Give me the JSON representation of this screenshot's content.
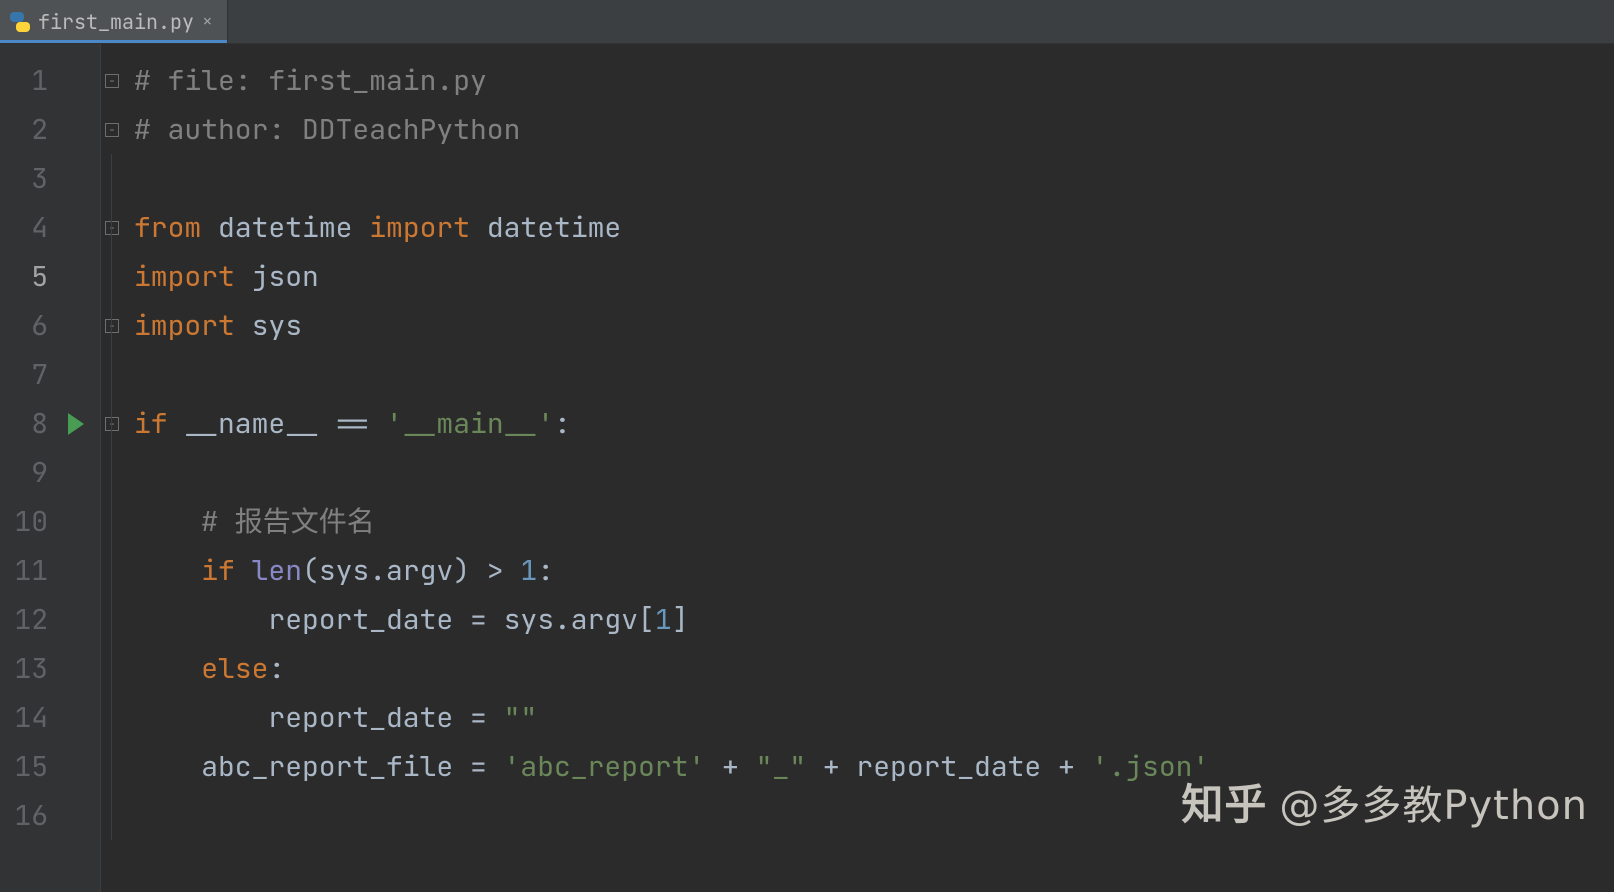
{
  "tab": {
    "filename": "first_main.py",
    "close": "×"
  },
  "code": {
    "lines": [
      {
        "n": "1",
        "segs": [
          {
            "cls": "c-comment",
            "t": "# file: first_main.py"
          }
        ],
        "fold": "-",
        "indent": 0
      },
      {
        "n": "2",
        "segs": [
          {
            "cls": "c-comment",
            "t": "# author: DDTeachPython"
          }
        ],
        "fold": "-",
        "indent": 0
      },
      {
        "n": "3",
        "segs": [],
        "indent": 0
      },
      {
        "n": "4",
        "segs": [
          {
            "cls": "c-keyword",
            "t": "from "
          },
          {
            "cls": "c-text",
            "t": "datetime "
          },
          {
            "cls": "c-keyword",
            "t": "import "
          },
          {
            "cls": "c-text",
            "t": "datetime"
          }
        ],
        "fold": "-",
        "indent": 0
      },
      {
        "n": "5",
        "segs": [
          {
            "cls": "c-keyword",
            "t": "import "
          },
          {
            "cls": "c-text",
            "t": "json"
          }
        ],
        "indent": 0,
        "hl": true
      },
      {
        "n": "6",
        "segs": [
          {
            "cls": "c-keyword",
            "t": "import "
          },
          {
            "cls": "c-text",
            "t": "sys"
          }
        ],
        "fold": "-",
        "indent": 0
      },
      {
        "n": "7",
        "segs": [],
        "indent": 0
      },
      {
        "n": "8",
        "segs": [
          {
            "cls": "c-keyword",
            "t": "if "
          },
          {
            "cls": "c-text",
            "t": "__name__ == "
          },
          {
            "cls": "c-str",
            "t": "'__main__'"
          },
          {
            "cls": "c-text",
            "t": ":"
          }
        ],
        "fold": "-",
        "run": true,
        "indent": 0
      },
      {
        "n": "9",
        "segs": [],
        "indent": 1
      },
      {
        "n": "10",
        "segs": [
          {
            "cls": "c-comment",
            "t": "# 报告文件名"
          }
        ],
        "indent": 1
      },
      {
        "n": "11",
        "segs": [
          {
            "cls": "c-keyword",
            "t": "if "
          },
          {
            "cls": "c-builtin",
            "t": "len"
          },
          {
            "cls": "c-text",
            "t": "(sys.argv) > "
          },
          {
            "cls": "c-num",
            "t": "1"
          },
          {
            "cls": "c-text",
            "t": ":"
          }
        ],
        "indent": 1
      },
      {
        "n": "12",
        "segs": [
          {
            "cls": "c-text",
            "t": "report_date = sys.argv["
          },
          {
            "cls": "c-num",
            "t": "1"
          },
          {
            "cls": "c-text",
            "t": "]"
          }
        ],
        "indent": 2
      },
      {
        "n": "13",
        "segs": [
          {
            "cls": "c-keyword",
            "t": "else"
          },
          {
            "cls": "c-text",
            "t": ":"
          }
        ],
        "indent": 1
      },
      {
        "n": "14",
        "segs": [
          {
            "cls": "c-text",
            "t": "report_date = "
          },
          {
            "cls": "c-str",
            "t": "\"\""
          }
        ],
        "indent": 2
      },
      {
        "n": "15",
        "segs": [
          {
            "cls": "c-text",
            "t": "abc_report_file = "
          },
          {
            "cls": "c-str",
            "t": "'abc_report'"
          },
          {
            "cls": "c-text",
            "t": " + "
          },
          {
            "cls": "c-str",
            "t": "\"_\""
          },
          {
            "cls": "c-text",
            "t": " + report_date + "
          },
          {
            "cls": "c-str",
            "t": "'.json'"
          }
        ],
        "indent": 1
      },
      {
        "n": "16",
        "segs": [],
        "indent": 1
      }
    ]
  },
  "watermark": {
    "logo": "知乎",
    "text": "@多多教Python"
  }
}
